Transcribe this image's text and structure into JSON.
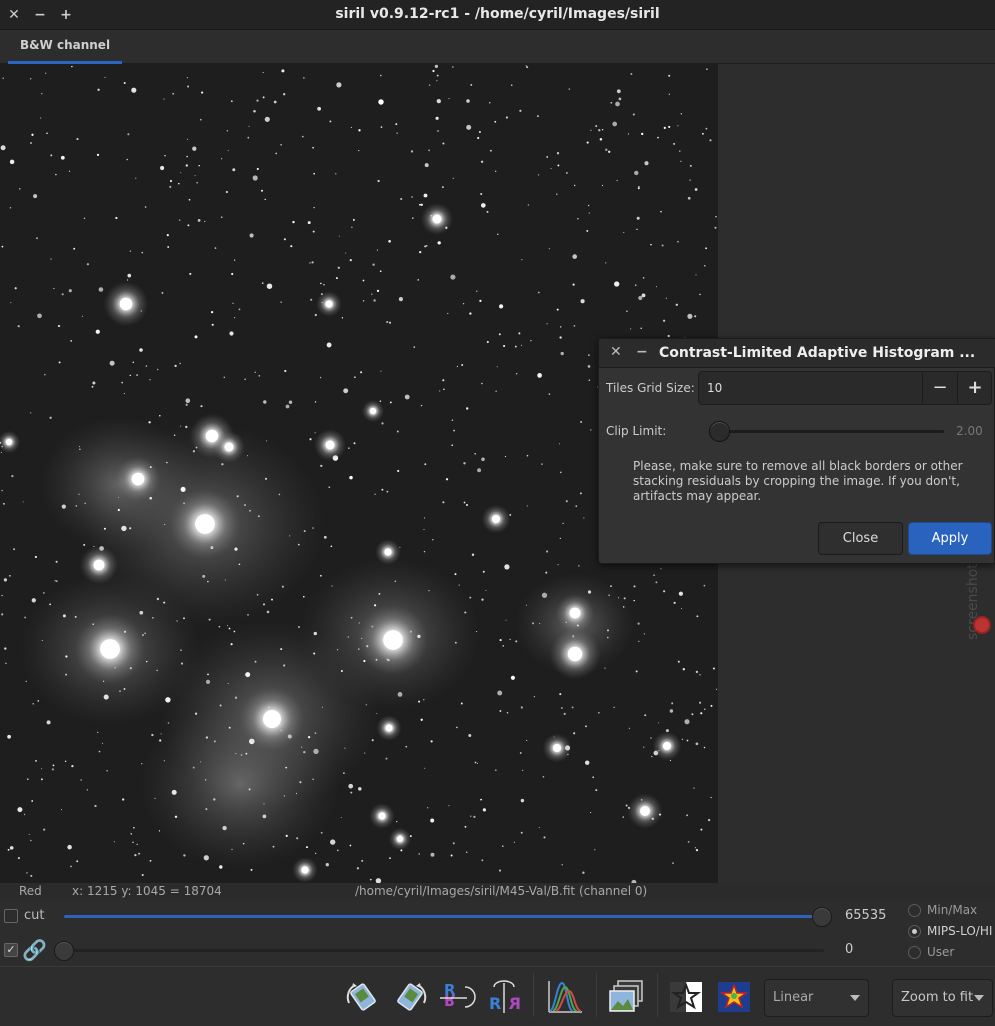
{
  "window": {
    "title": "siril v0.9.12-rc1 - /home/cyril/Images/siril",
    "controls": [
      "close-icon",
      "minimize-icon",
      "maximize-icon"
    ]
  },
  "tabs": [
    {
      "label": "B&W channel",
      "active": true
    }
  ],
  "status": {
    "channel": "Red",
    "coords": "x: 1215 y: 1045 = 18704",
    "file": "/home/cyril/Images/siril/M45-Val/B.fit (channel 0)"
  },
  "sliders": {
    "cut_label": "cut",
    "cut_checked": false,
    "hi_value": "65535",
    "lo_value": "0",
    "hi_level": 1.0,
    "lo_level": 0.0
  },
  "scaling_modes": [
    {
      "label": "Min/Max",
      "selected": false
    },
    {
      "label": "MIPS-LO/HI",
      "selected": true
    },
    {
      "label": "User",
      "selected": false
    }
  ],
  "toolbar": {
    "icons": [
      "rotate-ccw-icon",
      "rotate-cw-icon",
      "mirror-x-icon",
      "mirror-y-icon",
      "histogram-icon",
      "image-sequence-icon",
      "photometry-icon",
      "dynamic-psf-icon"
    ],
    "scale_combo": "Linear",
    "zoom_combo": "Zoom to fit"
  },
  "dialog": {
    "title": "Contrast-Limited Adaptive Histogram ...",
    "tiles_label": "Tiles Grid Size:",
    "tiles_value": "10",
    "minus": "−",
    "plus": "+",
    "clip_label": "Clip Limit:",
    "clip_value": "2.00",
    "clip_level": 0.0,
    "message": "Please, make sure to remove all black borders or other stacking residuals by cropping the image. If you don't, artifacts may appear.",
    "close_label": "Close",
    "apply_label": "Apply"
  },
  "watermark": "screenshots.debian.net",
  "colors": {
    "accent": "#2a63bd",
    "background": "#2d2d2d",
    "titlebar": "#232323"
  }
}
